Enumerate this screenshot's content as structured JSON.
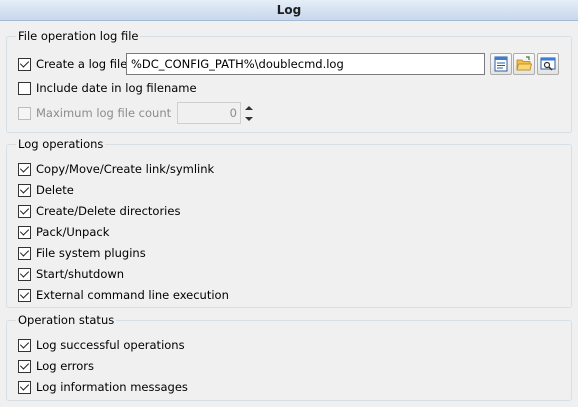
{
  "header": {
    "title": "Log"
  },
  "file_log_group": {
    "title": "File operation log file",
    "create_log": {
      "label": "Create a log file:",
      "checked": true
    },
    "log_path": {
      "value": "%DC_CONFIG_PATH%\\doublecmd.log"
    },
    "buttons": [
      {
        "name": "view-file-button",
        "icon": "document-view-icon"
      },
      {
        "name": "browse-folder-button",
        "icon": "folder-open-icon"
      },
      {
        "name": "open-viewer-button",
        "icon": "window-search-icon"
      }
    ],
    "include_date": {
      "label": "Include date in log filename",
      "checked": false
    },
    "max_count": {
      "label": "Maximum log file count",
      "checked": false,
      "disabled": true,
      "value": "0"
    }
  },
  "log_operations_group": {
    "title": "Log operations",
    "items": [
      {
        "label": "Copy/Move/Create link/symlink",
        "checked": true
      },
      {
        "label": "Delete",
        "checked": true
      },
      {
        "label": "Create/Delete directories",
        "checked": true
      },
      {
        "label": "Pack/Unpack",
        "checked": true
      },
      {
        "label": "File system plugins",
        "checked": true
      },
      {
        "label": "Start/shutdown",
        "checked": true
      },
      {
        "label": "External command line execution",
        "checked": true
      }
    ]
  },
  "operation_status_group": {
    "title": "Operation status",
    "items": [
      {
        "label": "Log successful operations",
        "checked": true
      },
      {
        "label": "Log errors",
        "checked": true
      },
      {
        "label": "Log information messages",
        "checked": true
      }
    ]
  },
  "colors": {
    "header_gradient_top": "#e6eef8",
    "header_gradient_bottom": "#c7d7ec",
    "background": "#f0f0f0",
    "group_border": "#d5dfe5"
  }
}
